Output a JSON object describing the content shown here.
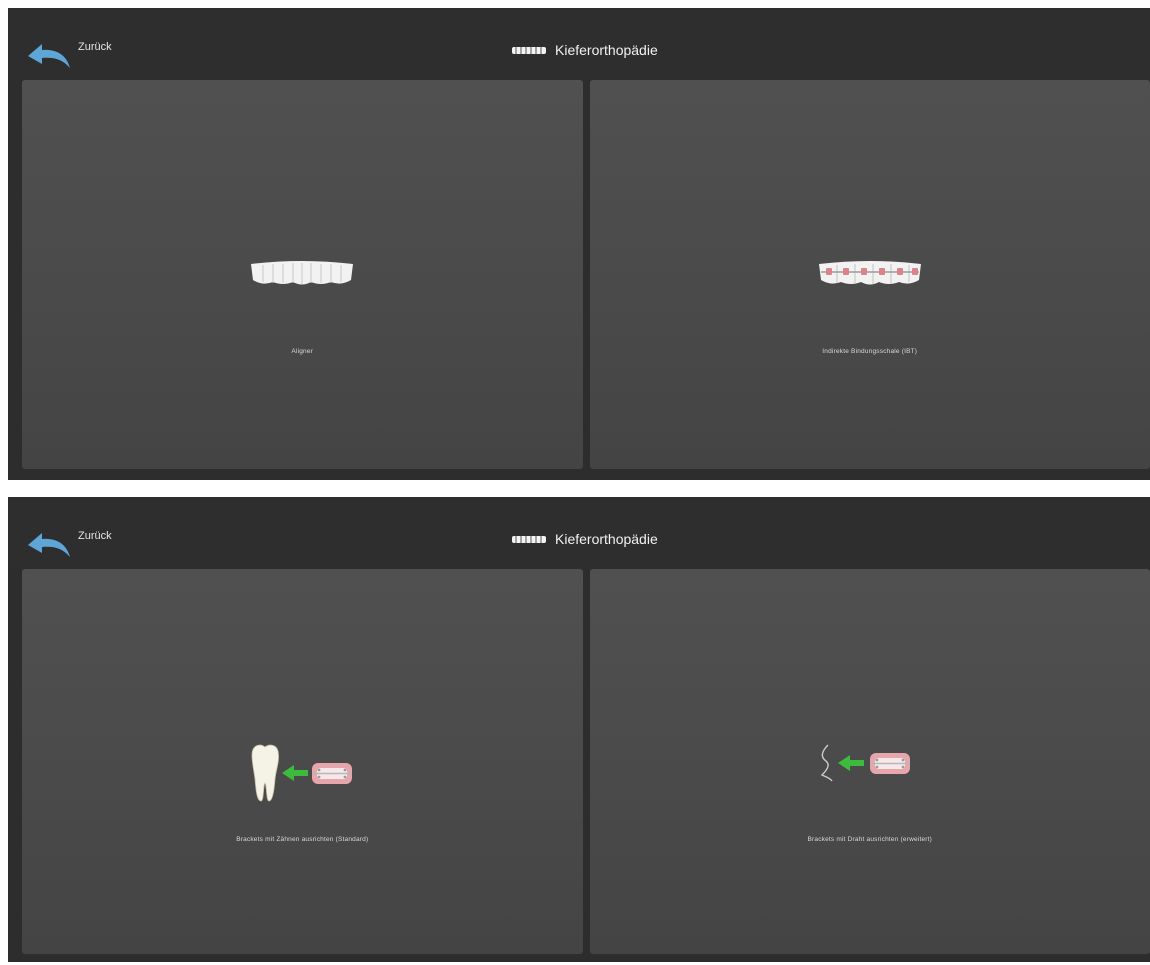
{
  "screens": [
    {
      "back_label": "Zurück",
      "title": "Kieferorthopädie",
      "tiles": [
        {
          "label": "Aligner",
          "icon": "aligner-teeth-icon"
        },
        {
          "label": "Indirekte Bindungsschale (IBT)",
          "icon": "braces-teeth-icon"
        }
      ]
    },
    {
      "back_label": "Zurück",
      "title": "Kieferorthopädie",
      "tiles": [
        {
          "label": "Brackets mit Zähnen ausrichten (Standard)",
          "icon": "tooth-bracket-align-icon"
        },
        {
          "label": "Brackets mit Draht ausrichten (erweitert)",
          "icon": "wire-bracket-align-icon"
        }
      ]
    }
  ],
  "colors": {
    "background": "#2d2d2d",
    "tile": "#4b4b4b",
    "back_arrow": "#5ea6d6",
    "align_arrow": "#3dbb3d"
  }
}
